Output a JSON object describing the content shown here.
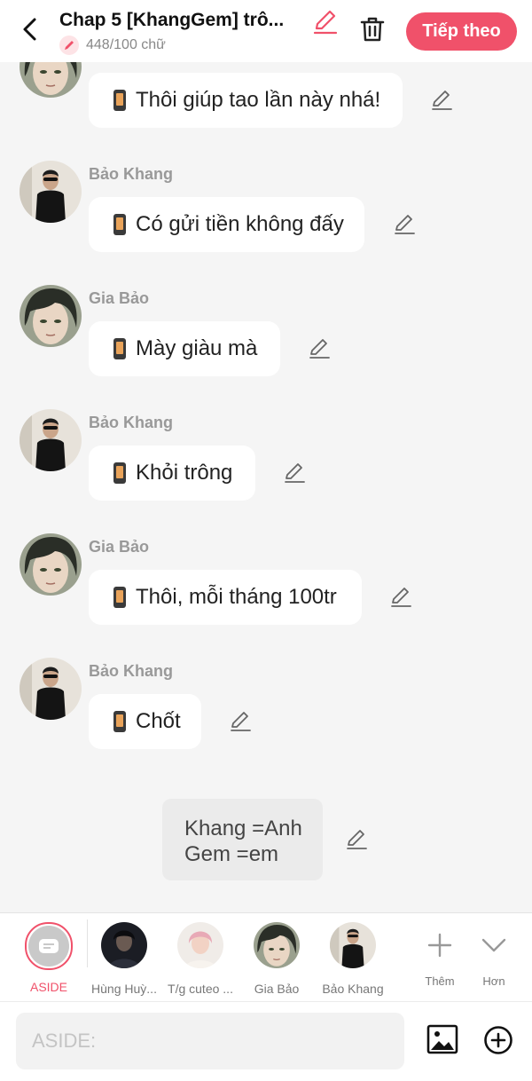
{
  "header": {
    "title": "Chap 5 [KhangGem] trô...",
    "word_count": "448/100 chữ",
    "next_label": "Tiếp theo",
    "accent": "#f0516a"
  },
  "messages": [
    {
      "sender": "",
      "text": "Thôi giúp tao lần này nhá!",
      "avatar": "gia-bao"
    },
    {
      "sender": "Bảo Khang",
      "text": "Có gửi tiền không đấy",
      "avatar": "bao-khang"
    },
    {
      "sender": "Gia Bảo",
      "text": "Mày giàu mà",
      "avatar": "gia-bao"
    },
    {
      "sender": "Bảo Khang",
      "text": "Khỏi trông",
      "avatar": "bao-khang"
    },
    {
      "sender": "Gia Bảo",
      "text": "Thôi, mỗi tháng 100tr",
      "avatar": "gia-bao"
    },
    {
      "sender": "Bảo Khang",
      "text": "Chốt",
      "avatar": "bao-khang"
    }
  ],
  "aside_note": "Khang =Anh\nGem =em",
  "characters": [
    {
      "label": "ASIDE"
    },
    {
      "label": "Hùng Huỳ..."
    },
    {
      "label": "T/g cuteo ..."
    },
    {
      "label": "Gia Bảo"
    },
    {
      "label": "Bảo Khang"
    },
    {
      "label": "Thêm"
    },
    {
      "label": "Hơn"
    }
  ],
  "input": {
    "placeholder": "ASIDE:"
  }
}
